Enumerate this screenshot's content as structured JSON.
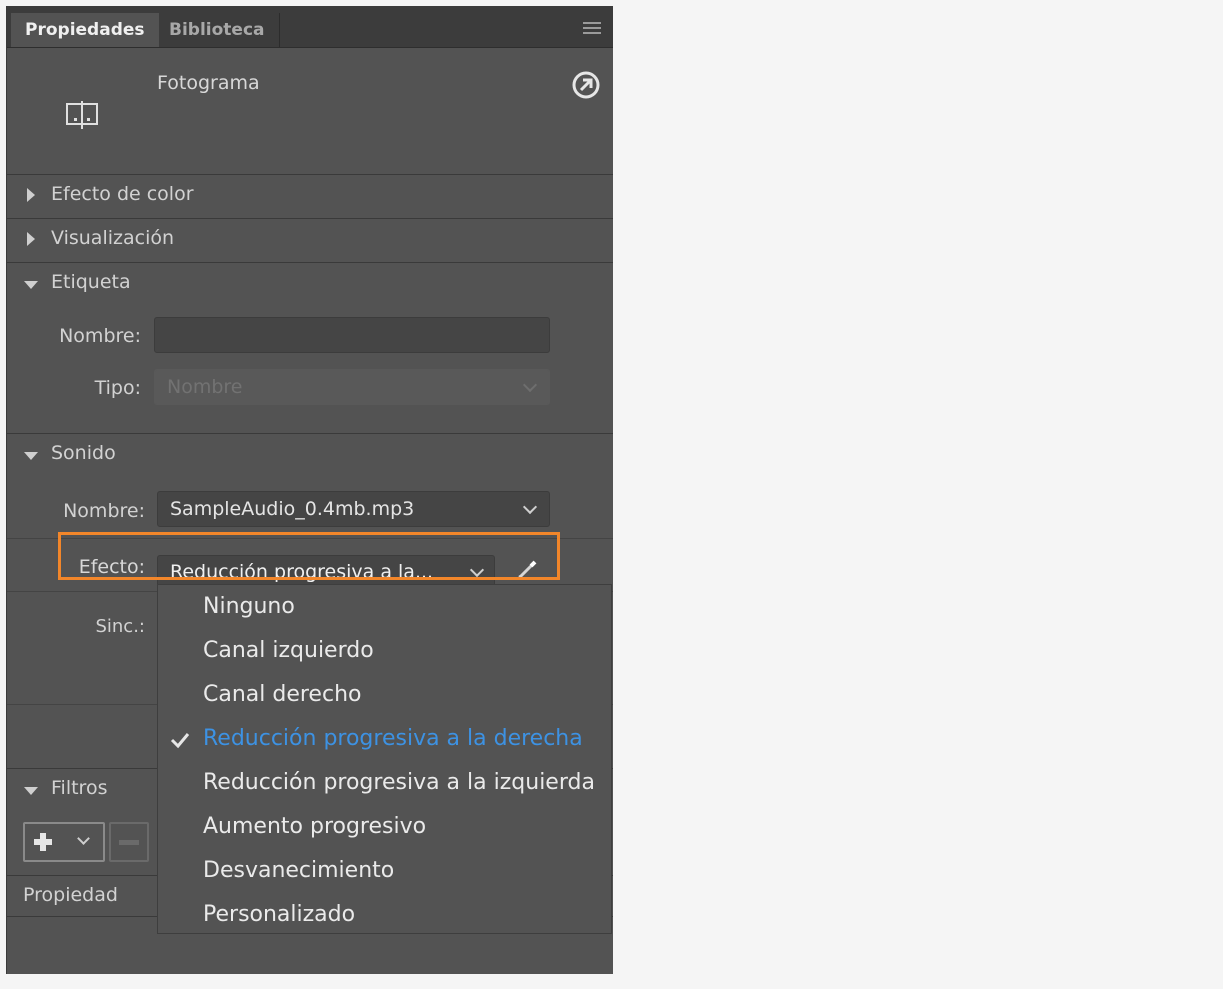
{
  "tabs": [
    {
      "label": "Propiedades",
      "active": true
    },
    {
      "label": "Biblioteca",
      "active": false
    }
  ],
  "header": {
    "title": "Fotograma"
  },
  "sections": {
    "color_effect": "Efecto de color",
    "display": "Visualización",
    "label": "Etiqueta",
    "sound": "Sonido",
    "filters": "Filtros"
  },
  "label_section": {
    "name_label": "Nombre:",
    "name_value": "",
    "type_label": "Tipo:",
    "type_value": "Nombre"
  },
  "sound_section": {
    "name_label": "Nombre:",
    "name_value": "SampleAudio_0.4mb.mp3",
    "effect_label": "Efecto:",
    "effect_value": "Reducción progresiva a la...",
    "sync_label": "Sinc.:"
  },
  "effect_options": [
    {
      "label": "Ninguno",
      "selected": false
    },
    {
      "label": "Canal izquierdo",
      "selected": false
    },
    {
      "label": "Canal derecho",
      "selected": false
    },
    {
      "label": "Reducción progresiva a la derecha",
      "selected": true
    },
    {
      "label": "Reducción progresiva a la izquierda",
      "selected": false
    },
    {
      "label": "Aumento progresivo",
      "selected": false
    },
    {
      "label": "Desvanecimiento",
      "selected": false
    },
    {
      "label": "Personalizado",
      "selected": false
    }
  ],
  "filters": {
    "column_header": "Propiedad"
  },
  "colors": {
    "accent": "#3d92e3",
    "highlight_border": "#f2862a",
    "panel_bg": "#535353"
  },
  "icons": [
    "frame-icon",
    "goto-arrow-icon",
    "pencil-icon",
    "check-icon",
    "plus-icon",
    "minus-icon",
    "menu-icon"
  ]
}
